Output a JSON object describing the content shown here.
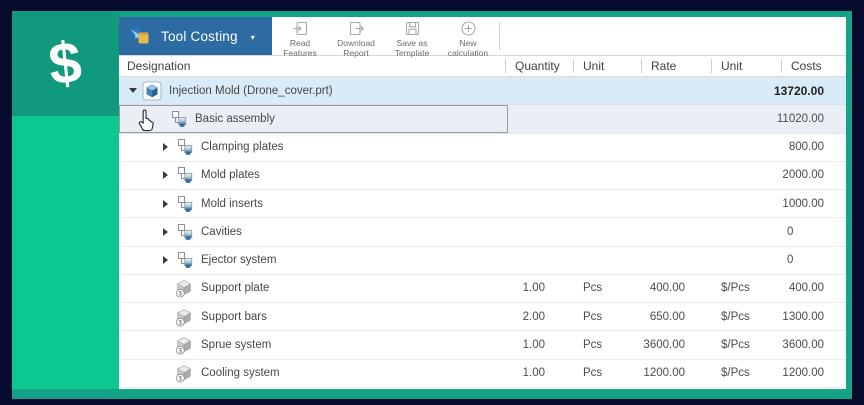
{
  "colors": {
    "background_navy": "#070b2d",
    "frame_teal": "#14a386",
    "brand_panel_dark": "#11997d",
    "brand_panel_bright": "#0cc78f",
    "app_button_blue": "#2d6ba3",
    "root_row_blue": "#d9ebf7",
    "selected_row_blue": "#e9eff5"
  },
  "brand": {
    "dollar_symbol": "$"
  },
  "toolbar": {
    "app_button": {
      "label": "Tool Costing",
      "caret": "▾"
    },
    "buttons": [
      {
        "icon": "read-features-icon",
        "label_line1": "Read",
        "label_line2": "Features"
      },
      {
        "icon": "download-report-icon",
        "label_line1": "Download",
        "label_line2": "Report"
      },
      {
        "icon": "save-as-template-icon",
        "label_line1": "Save as",
        "label_line2": "Template"
      },
      {
        "icon": "new-calculation-icon",
        "label_line1": "New",
        "label_line2": "calculation"
      }
    ]
  },
  "table": {
    "columns": [
      "Designation",
      "Quantity",
      "Unit",
      "Rate",
      "Unit",
      "Costs"
    ],
    "rows": [
      {
        "label": "Injection Mold (Drone_cover.prt)",
        "level": 0,
        "icon": "part",
        "expander": "expanded",
        "quantity": "",
        "unit": "",
        "rate": "",
        "rate_unit": "",
        "costs": "13720.00",
        "bold": true,
        "bg": "blue"
      },
      {
        "label": "Basic assembly",
        "level": 1,
        "icon": "assembly",
        "expander": "none",
        "cursor": true,
        "selected": true,
        "quantity": "",
        "unit": "",
        "rate": "",
        "rate_unit": "",
        "costs": "11020.00",
        "bg": "sel"
      },
      {
        "label": "Clamping plates",
        "level": 2,
        "icon": "assembly",
        "expander": "collapsed",
        "quantity": "",
        "unit": "",
        "rate": "",
        "rate_unit": "",
        "costs": "800.00"
      },
      {
        "label": "Mold plates",
        "level": 2,
        "icon": "assembly",
        "expander": "collapsed",
        "quantity": "",
        "unit": "",
        "rate": "",
        "rate_unit": "",
        "costs": "2000.00"
      },
      {
        "label": "Mold inserts",
        "level": 2,
        "icon": "assembly",
        "expander": "collapsed",
        "quantity": "",
        "unit": "",
        "rate": "",
        "rate_unit": "",
        "costs": "1000.00"
      },
      {
        "label": "Cavities",
        "level": 2,
        "icon": "assembly",
        "expander": "collapsed",
        "quantity": "",
        "unit": "",
        "rate": "",
        "rate_unit": "",
        "costs": "0",
        "zero": true
      },
      {
        "label": "Ejector system",
        "level": 2,
        "icon": "assembly",
        "expander": "collapsed",
        "quantity": "",
        "unit": "",
        "rate": "",
        "rate_unit": "",
        "costs": "0",
        "zero": true
      },
      {
        "label": "Support plate",
        "level": 3,
        "icon": "component",
        "expander": "none",
        "quantity": "1.00",
        "unit": "Pcs",
        "rate": "400.00",
        "rate_unit": "$/Pcs",
        "costs": "400.00"
      },
      {
        "label": "Support bars",
        "level": 3,
        "icon": "component",
        "expander": "none",
        "quantity": "2.00",
        "unit": "Pcs",
        "rate": "650.00",
        "rate_unit": "$/Pcs",
        "costs": "1300.00"
      },
      {
        "label": "Sprue system",
        "level": 3,
        "icon": "component",
        "expander": "none",
        "quantity": "1.00",
        "unit": "Pcs",
        "rate": "3600.00",
        "rate_unit": "$/Pcs",
        "costs": "3600.00"
      },
      {
        "label": "Cooling system",
        "level": 3,
        "icon": "component",
        "expander": "none",
        "quantity": "1.00",
        "unit": "Pcs",
        "rate": "1200.00",
        "rate_unit": "$/Pcs",
        "costs": "1200.00"
      }
    ]
  }
}
